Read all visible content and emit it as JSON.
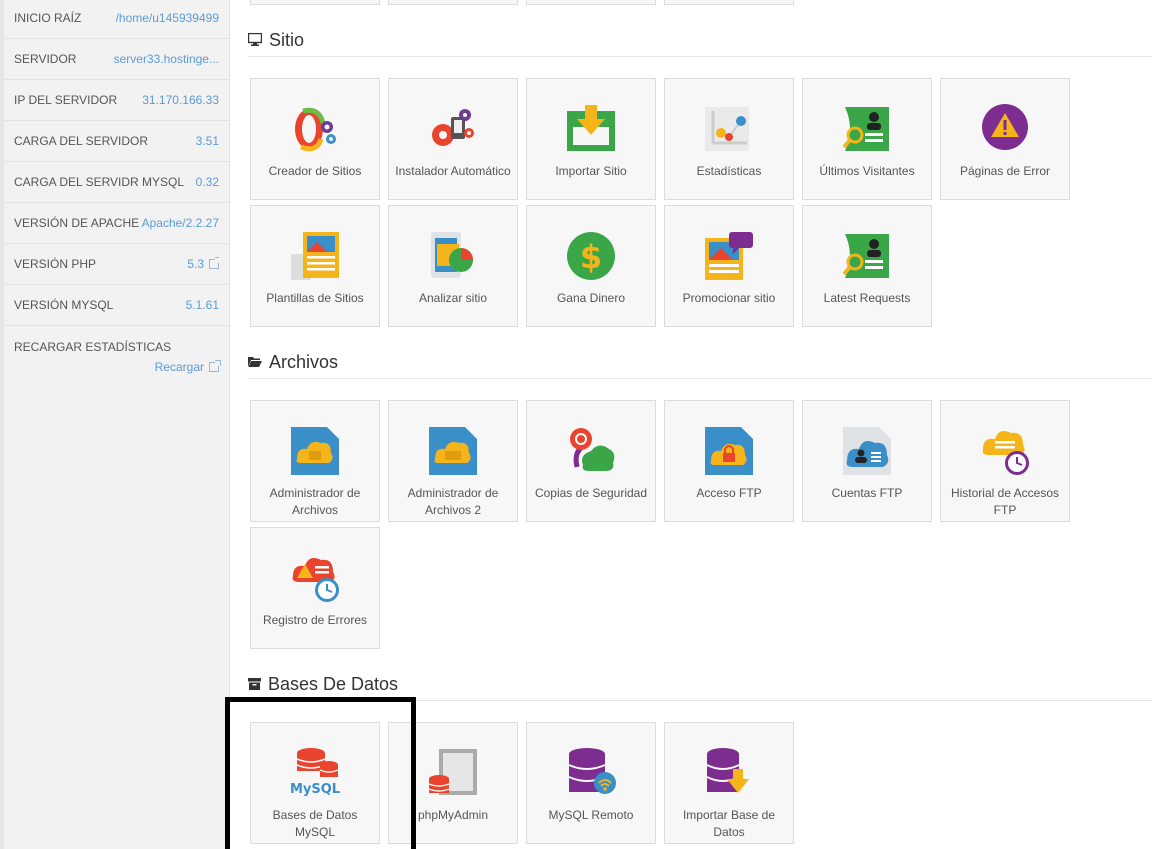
{
  "sidebar": {
    "rows": [
      {
        "key": "INICIO RAÍZ",
        "value": "/home/u145939499"
      },
      {
        "key": "SERVIDOR",
        "value": "server33.hostinge..."
      },
      {
        "key": "IP DEL SERVIDOR",
        "value": "31.170.166.33"
      },
      {
        "key": "CARGA DEL SERVIDOR",
        "value": "3.51"
      },
      {
        "key": "CARGA DEL SERVIDR MYSQL",
        "value": "0.32"
      },
      {
        "key": "VERSIÓN DE APACHE",
        "value": "Apache/2.2.27"
      },
      {
        "key": "VERSIÓN PHP",
        "value": "5.3"
      },
      {
        "key": "VERSIÓN MYSQL",
        "value": "5.1.61"
      }
    ],
    "reload": {
      "key": "RECARGAR ESTADÍSTICAS",
      "value": "Recargar"
    }
  },
  "sections": {
    "sitio": {
      "title": "Sitio",
      "tiles": [
        {
          "label": "Creador de Sitios",
          "icon": "site-builder-icon"
        },
        {
          "label": "Instalador Automático",
          "icon": "auto-installer-icon"
        },
        {
          "label": "Importar Sitio",
          "icon": "import-site-icon"
        },
        {
          "label": "Estadísticas",
          "icon": "statistics-icon"
        },
        {
          "label": "Últimos Visitantes",
          "icon": "last-visitors-icon"
        },
        {
          "label": "Páginas de Error",
          "icon": "error-pages-icon"
        },
        {
          "label": "Plantillas de Sitios",
          "icon": "site-templates-icon"
        },
        {
          "label": "Analizar sitio",
          "icon": "analyze-site-icon"
        },
        {
          "label": "Gana Dinero",
          "icon": "make-money-icon"
        },
        {
          "label": "Promocionar sitio",
          "icon": "promote-site-icon"
        },
        {
          "label": "Latest Requests",
          "icon": "latest-requests-icon"
        }
      ]
    },
    "archivos": {
      "title": "Archivos",
      "tiles": [
        {
          "label": "Administrador de Archivos",
          "icon": "file-manager-icon"
        },
        {
          "label": "Administrador de Archivos 2",
          "icon": "file-manager-2-icon"
        },
        {
          "label": "Copias de Seguridad",
          "icon": "backups-icon"
        },
        {
          "label": "Acceso FTP",
          "icon": "ftp-access-icon"
        },
        {
          "label": "Cuentas FTP",
          "icon": "ftp-accounts-icon"
        },
        {
          "label": "Historial de Accesos FTP",
          "icon": "ftp-history-icon"
        },
        {
          "label": "Registro de Errores",
          "icon": "error-log-icon"
        }
      ]
    },
    "bases": {
      "title": "Bases De Datos",
      "tiles": [
        {
          "label": "Bases de Datos MySQL",
          "icon": "mysql-databases-icon",
          "icon_text": "MySQL"
        },
        {
          "label": "phpMyAdmin",
          "icon": "phpmyadmin-icon"
        },
        {
          "label": "MySQL Remoto",
          "icon": "remote-mysql-icon"
        },
        {
          "label": "Importar Base de Datos",
          "icon": "import-database-icon"
        }
      ]
    }
  },
  "colors": {
    "link": "#5b9bd5",
    "tile_bg": "#f7f7f7",
    "highlight": "#000000"
  }
}
